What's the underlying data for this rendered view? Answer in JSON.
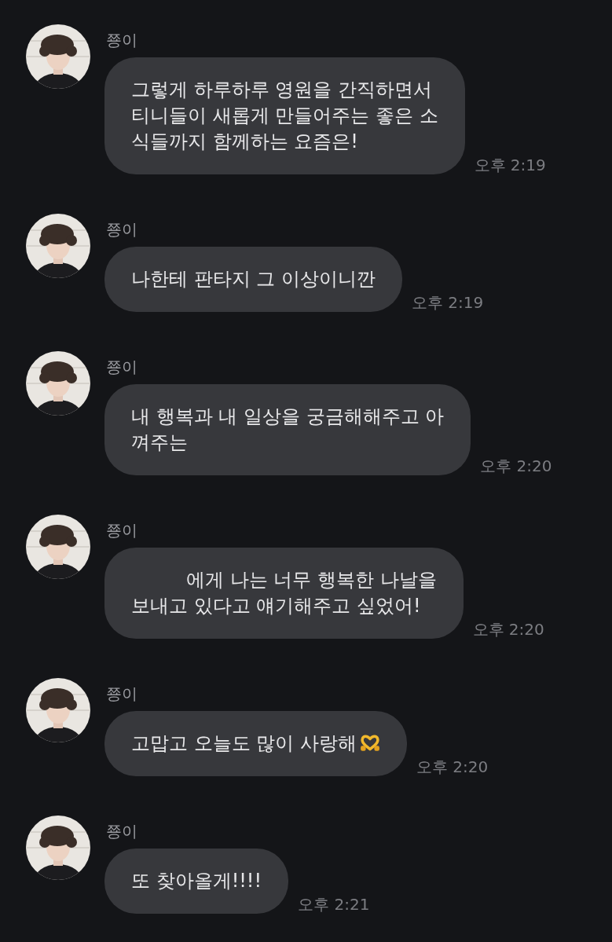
{
  "messages": [
    {
      "sender": "쭁이",
      "lines": [
        "그렇게 하루하루 영원을 간직하면서",
        "티니들이 새롭게 만들어주는 좋은 소",
        "식들까지 함께하는 요즘은!"
      ],
      "time": "오후 2:19"
    },
    {
      "sender": "쭁이",
      "lines": [
        "나한테 판타지 그 이상이니깐"
      ],
      "time": "오후 2:19"
    },
    {
      "sender": "쭁이",
      "lines": [
        "내 행복과 내 일상을 궁금해해주고 아",
        "껴주는"
      ],
      "time": "오후 2:20"
    },
    {
      "sender": "쭁이",
      "lead_gap": true,
      "lines": [
        "에게 나는 너무 행복한 나날을",
        "보내고 있다고 얘기해주고 싶었어!"
      ],
      "time": "오후 2:20"
    },
    {
      "sender": "쭁이",
      "trailing_icon": true,
      "lines": [
        "고맙고 오늘도 많이 사랑해"
      ],
      "time": "오후 2:20"
    },
    {
      "sender": "쭁이",
      "lines": [
        "또 찾아올게!!!!"
      ],
      "time": "오후 2:21"
    }
  ]
}
